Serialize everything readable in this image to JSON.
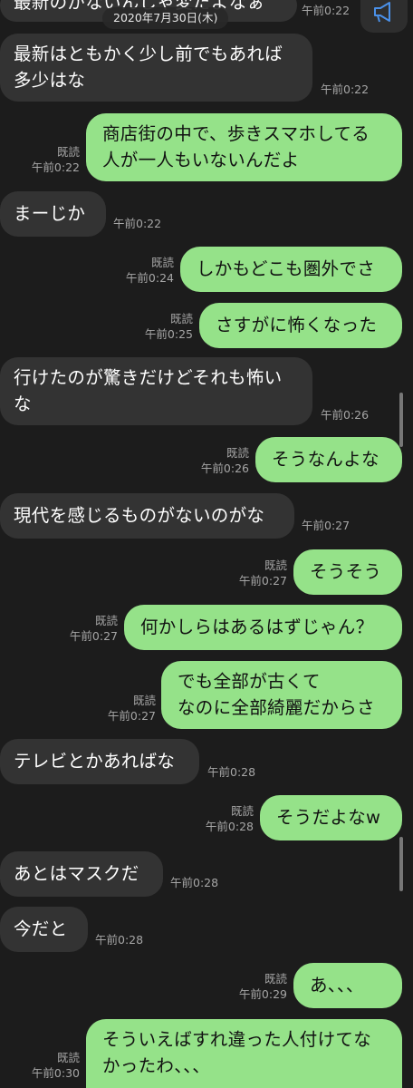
{
  "date_label": "2020年7月30日(木)",
  "announce_icon": "megaphone-icon",
  "colors": {
    "background": "#1c1c1c",
    "incoming_bubble": "#333333",
    "outgoing_bubble": "#95e289",
    "meta_text": "#a6a6a6"
  },
  "messages": [
    {
      "side": "left",
      "text": "最新のがないんじゃ変だよなぁ",
      "time": "午前0:22"
    },
    {
      "side": "left",
      "text": "最新はともかく少し前でもあれば\n多少はな",
      "time": "午前0:22"
    },
    {
      "side": "right",
      "text": "商店街の中で、歩きスマホしてる\n人が一人もいないんだよ",
      "read": "既読",
      "time": "午前0:22"
    },
    {
      "side": "left",
      "text": "まーじか",
      "time": "午前0:22"
    },
    {
      "side": "right",
      "text": "しかもどこも圏外でさ",
      "read": "既読",
      "time": "午前0:24"
    },
    {
      "side": "right",
      "text": "さすがに怖くなった",
      "read": "既読",
      "time": "午前0:25"
    },
    {
      "side": "left",
      "text": "行けたのが驚きだけどそれも怖い\nな",
      "time": "午前0:26"
    },
    {
      "side": "right",
      "text": "そうなんよな",
      "read": "既読",
      "time": "午前0:26"
    },
    {
      "side": "left",
      "text": "現代を感じるものがないのがな",
      "time": "午前0:27"
    },
    {
      "side": "right",
      "text": "そうそう",
      "read": "既読",
      "time": "午前0:27"
    },
    {
      "side": "right",
      "text": "何かしらはあるはずじゃん？",
      "read": "既読",
      "time": "午前0:27"
    },
    {
      "side": "right",
      "text": "でも全部が古くて\nなのに全部綺麗だからさ",
      "read": "既読",
      "time": "午前0:27"
    },
    {
      "side": "left",
      "text": "テレビとかあればな",
      "time": "午前0:28"
    },
    {
      "side": "right",
      "text": "そうだよなw",
      "read": "既読",
      "time": "午前0:28"
    },
    {
      "side": "left",
      "text": "あとはマスクだ",
      "time": "午前0:28"
    },
    {
      "side": "left",
      "text": "今だと",
      "time": "午前0:28"
    },
    {
      "side": "right",
      "text": "あ、、、",
      "read": "既読",
      "time": "午前0:29"
    },
    {
      "side": "right",
      "text": "そういえばすれ違った人付けてな\nかったわ、、、",
      "read": "既読",
      "time": "午前0:30"
    }
  ]
}
